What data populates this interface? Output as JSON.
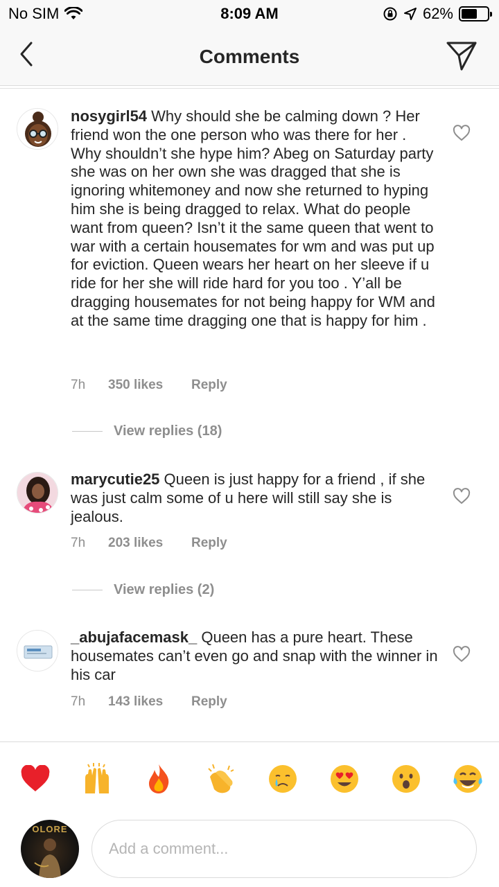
{
  "status_bar": {
    "carrier": "No SIM",
    "time": "8:09 AM",
    "battery_percent": "62%",
    "battery_level": 0.62,
    "icons": [
      "wifi-icon",
      "rotation-lock-icon",
      "location-icon",
      "battery-icon"
    ]
  },
  "nav": {
    "title": "Comments",
    "back_icon": "chevron-left-icon",
    "send_icon": "paper-plane-icon"
  },
  "comments": [
    {
      "username": "nosygirl54",
      "text": " Why should she be calming down ? Her friend won the one person who was there for her . Why shouldn’t she hype him? Abeg on Saturday party she was on her own she was dragged that she is ignoring whitemoney and now she returned to hyping him she is being dragged to relax. What do people want from queen?  Isn’t it the same queen that went to war with a certain housemates for wm and was put up for eviction. Queen wears her heart on her sleeve if u ride for her she will ride hard for you too . Y’all be dragging housemates for not being happy for WM and at the same time dragging one that is happy for him .",
      "time": "7h",
      "likes": "350 likes",
      "reply": "Reply",
      "view_replies": "View replies (18)"
    },
    {
      "username": "marycutie25",
      "text": " Queen is just happy for a friend , if she was just calm some of u here will still say she is jealous.",
      "time": "7h",
      "likes": "203 likes",
      "reply": "Reply",
      "view_replies": "View replies (2)"
    },
    {
      "username": "_abujafacemask_",
      "text": " Queen has a pure heart. These housemates can’t even go and snap with the winner in his car",
      "time": "7h",
      "likes": "143 likes",
      "reply": "Reply"
    }
  ],
  "reactions": [
    "❤️",
    "🙌",
    "🔥",
    "👏",
    "😢",
    "😍",
    "😮",
    "😂"
  ],
  "composer": {
    "placeholder": "Add a comment...",
    "avatar_text": "OLORE"
  }
}
